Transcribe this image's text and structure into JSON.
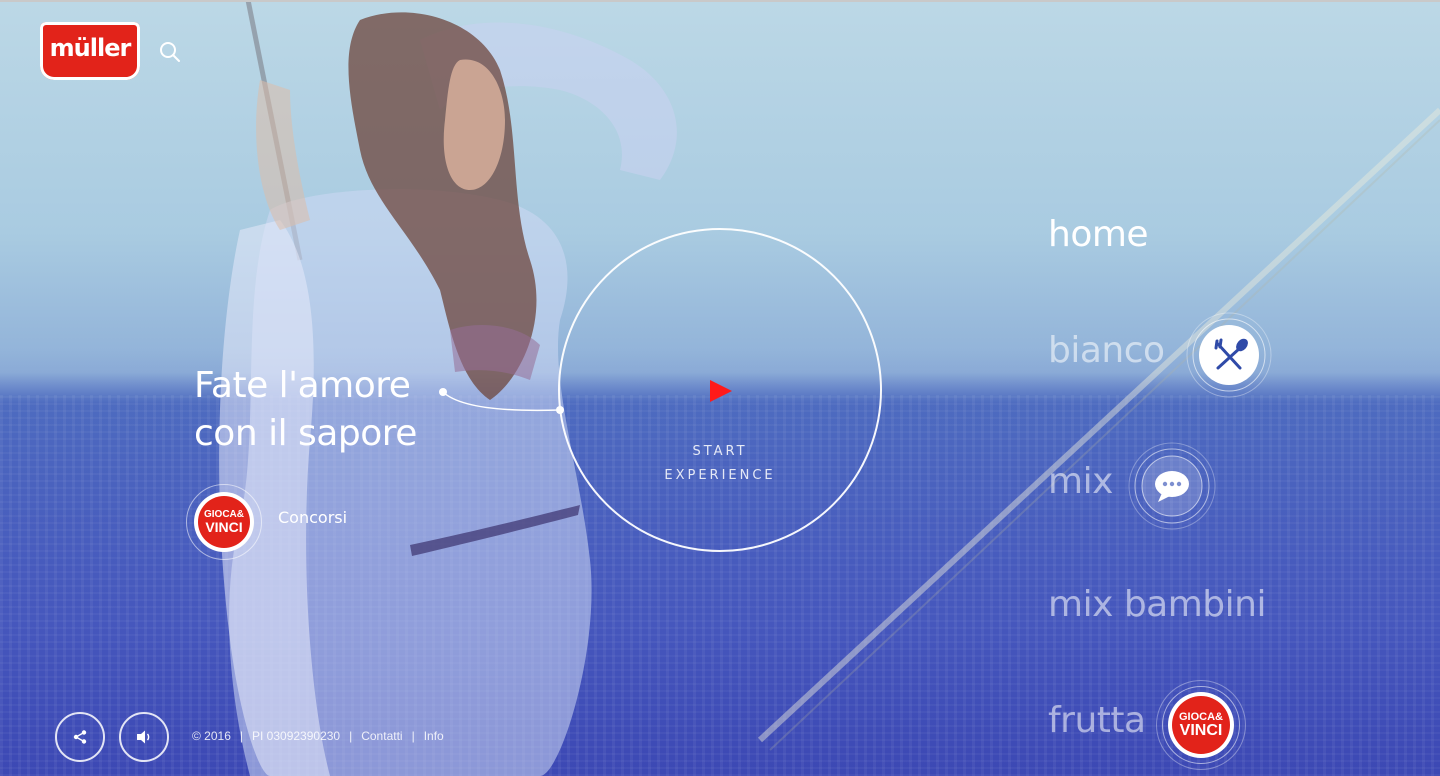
{
  "brand": {
    "logo_text": "müller"
  },
  "header": {
    "search_icon": "search-icon"
  },
  "hero": {
    "headline_line1": "Fate l'amore",
    "headline_line2": "con il sapore",
    "start_line1": "START",
    "start_line2": "EXPERIENCE",
    "play_color": "#ff1a1a"
  },
  "concorsi": {
    "badge_line1": "GIOCA&",
    "badge_line2": "VINCI",
    "label": "Concorsi"
  },
  "nav": {
    "items": [
      {
        "label": "home",
        "active": true
      },
      {
        "label": "bianco",
        "icon": "fork-spoon-icon"
      },
      {
        "label": "mix",
        "icon": "chat-bubble-icon"
      },
      {
        "label": "mix bambini"
      },
      {
        "label": "frutta",
        "badge_line1": "GIOCA&",
        "badge_line2": "VINCI"
      }
    ]
  },
  "footer": {
    "share_icon": "share-icon",
    "sound_icon": "speaker-icon",
    "copyright": "© 2016",
    "vat": "PI 03092390230",
    "contatti": "Contatti",
    "info": "Info",
    "separator": "|"
  },
  "colors": {
    "brand_red": "#e2231a",
    "nav_icon_blue": "#2f4aa8",
    "background_blue": "#3f52b9"
  }
}
